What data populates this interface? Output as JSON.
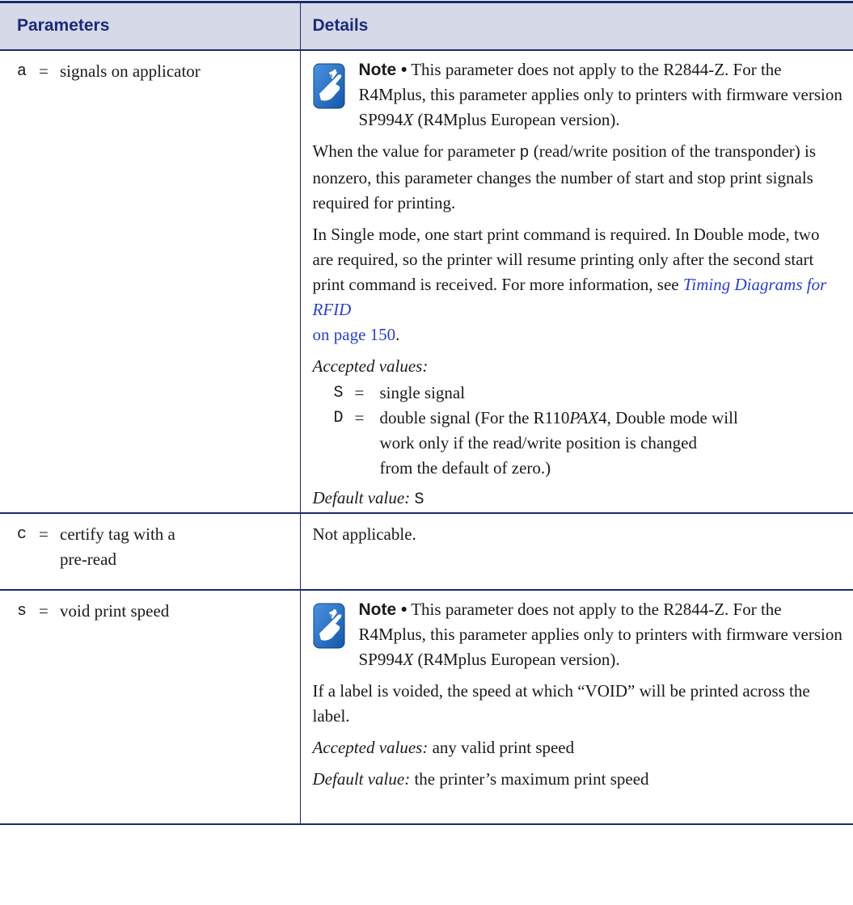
{
  "header": {
    "col_parameters": "Parameters",
    "col_details": "Details"
  },
  "row_a": {
    "code": "a",
    "eq": "=",
    "name": "signals on applicator",
    "note_label": "Note •",
    "note_text_1": " This parameter does not apply to the R2844-Z. For the R4Mplus, this parameter applies only to printers with firmware version SP994",
    "note_italic_x": "X",
    "note_text_2": " (R4Mplus European version).",
    "para1_a": "When the value for parameter ",
    "para1_code": "p",
    "para1_b": " (read/write position of the transponder) is nonzero, this parameter changes the number of start and stop print signals required for printing.",
    "para2": "In Single mode, one start print command is required. In Double mode, two are required, so the printer will resume printing only after the second start print command is received. For more information, see ",
    "para2_link": "Timing Diagrams for RFID",
    "para2_link_page": "on page 150",
    "para2_end": ".",
    "accepted_label": "Accepted values:",
    "values": [
      {
        "code": "S",
        "eq": "=",
        "text": "single signal"
      },
      {
        "code": "D",
        "eq": "=",
        "text_a": "double signal (For the R110",
        "text_italic": "PAX",
        "text_b": "4, Double mode will",
        "cont1": "work only if the read/write position is changed",
        "cont2": "from the default of zero.)"
      }
    ],
    "default_label": "Default value:",
    "default_value": "S"
  },
  "row_c": {
    "code": "c",
    "eq": "=",
    "name_line1": "certify tag with a",
    "name_line2": "pre-read",
    "details": "Not applicable."
  },
  "row_s": {
    "code": "s",
    "eq": "=",
    "name": "void print speed",
    "note_label": "Note •",
    "note_text_1": " This parameter does not apply to the R2844-Z. For the R4Mplus, this parameter applies only to printers with firmware version SP994",
    "note_italic_x": "X",
    "note_text_2": " (R4Mplus European version).",
    "para1": "If a label is voided, the speed at which “VOID” will be printed across the label.",
    "accepted_label": "Accepted values:",
    "accepted_value": " any valid print speed",
    "default_label": "Default value:",
    "default_value": " the printer’s maximum print speed"
  },
  "icons": {
    "note": "note-hand-icon",
    "color": "#1e6fc4"
  }
}
